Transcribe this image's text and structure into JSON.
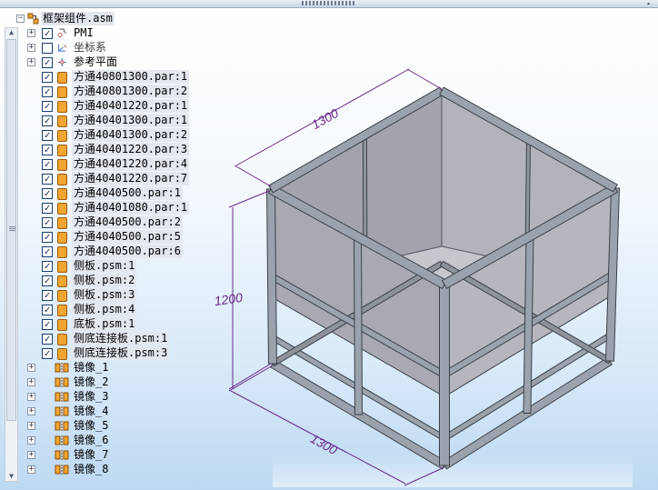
{
  "window": {
    "scroll_right_glyph": "▸"
  },
  "tree": {
    "root_label": "框架组件.asm",
    "items": [
      {
        "label": "PMI",
        "type": "pmi",
        "expander": "+",
        "checked": true
      },
      {
        "label": "坐标系",
        "type": "coord",
        "expander": "+",
        "checked": false
      },
      {
        "label": "参考平面",
        "type": "plane",
        "expander": "+",
        "checked": true
      },
      {
        "label": "方通40801300.par:1",
        "type": "part",
        "checked": true
      },
      {
        "label": "方通40801300.par:2",
        "type": "part",
        "checked": true
      },
      {
        "label": "方通40401220.par:1",
        "type": "part",
        "checked": true
      },
      {
        "label": "方通40401300.par:1",
        "type": "part",
        "checked": true
      },
      {
        "label": "方通40401300.par:2",
        "type": "part",
        "checked": true
      },
      {
        "label": "方通40401220.par:3",
        "type": "part",
        "checked": true
      },
      {
        "label": "方通40401220.par:4",
        "type": "part",
        "checked": true
      },
      {
        "label": "方通40401220.par:7",
        "type": "part",
        "checked": true
      },
      {
        "label": "方通4040500.par:1",
        "type": "part",
        "checked": true
      },
      {
        "label": "方通40401080.par:1",
        "type": "part",
        "checked": true
      },
      {
        "label": "方通4040500.par:2",
        "type": "part",
        "checked": true
      },
      {
        "label": "方通4040500.par:5",
        "type": "part",
        "checked": true
      },
      {
        "label": "方通4040500.par:6",
        "type": "part",
        "checked": true
      },
      {
        "label": "侧板.psm:1",
        "type": "part",
        "checked": true
      },
      {
        "label": "侧板.psm:2",
        "type": "part",
        "checked": true
      },
      {
        "label": "侧板.psm:3",
        "type": "part",
        "checked": true
      },
      {
        "label": "侧板.psm:4",
        "type": "part",
        "checked": true
      },
      {
        "label": "底板.psm:1",
        "type": "part",
        "checked": true
      },
      {
        "label": "侧底连接板.psm:1",
        "type": "part",
        "checked": true
      },
      {
        "label": "侧底连接板.psm:3",
        "type": "part",
        "checked": true
      },
      {
        "label": "镜像_1",
        "type": "mirror",
        "expander": "+"
      },
      {
        "label": "镜像_2",
        "type": "mirror",
        "expander": "+"
      },
      {
        "label": "镜像_3",
        "type": "mirror",
        "expander": "+"
      },
      {
        "label": "镜像_4",
        "type": "mirror",
        "expander": "+"
      },
      {
        "label": "镜像_5",
        "type": "mirror",
        "expander": "+"
      },
      {
        "label": "镜像_6",
        "type": "mirror",
        "expander": "+"
      },
      {
        "label": "镜像_7",
        "type": "mirror",
        "expander": "+"
      },
      {
        "label": "镜像_8",
        "type": "mirror",
        "expander": "+"
      }
    ]
  },
  "model": {
    "dim_top": "1300",
    "dim_height": "1200",
    "dim_bottom": "1300",
    "dim_color": "#6a2a8a",
    "frame_color": "#9aa3ad",
    "panel_color": "#a9a9b3"
  }
}
